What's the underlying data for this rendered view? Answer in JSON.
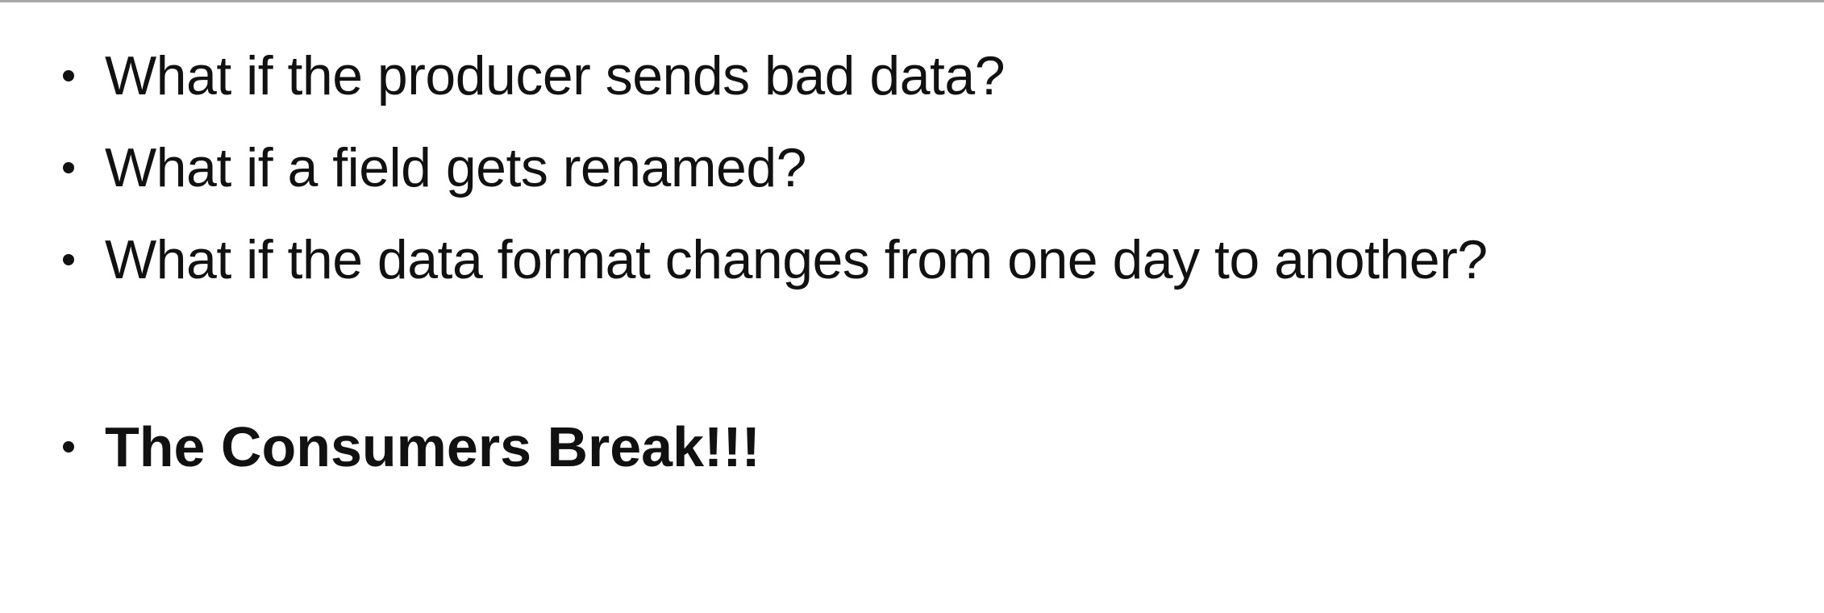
{
  "slide": {
    "bullets": [
      "What if the producer sends bad data?",
      "What if a field gets renamed?",
      "What if the data format changes from one day to another?"
    ],
    "conclusion": "The Consumers Break!!!"
  }
}
